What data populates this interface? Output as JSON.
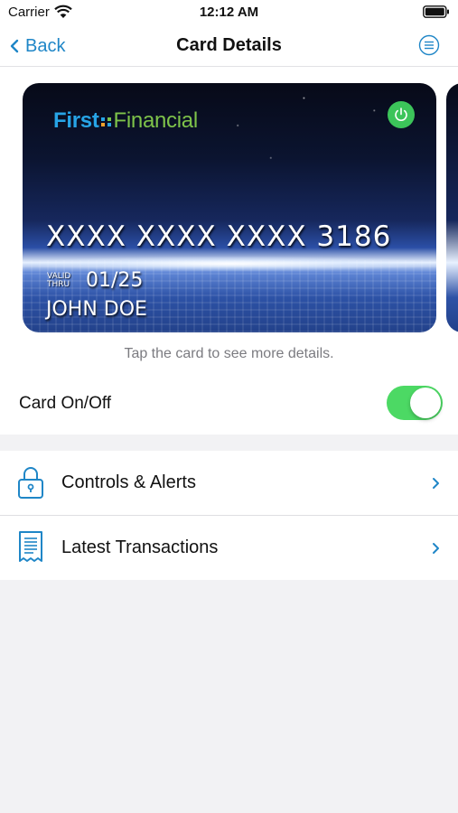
{
  "status_bar": {
    "carrier": "Carrier",
    "time": "12:12 AM"
  },
  "nav": {
    "back_label": "Back",
    "title": "Card Details"
  },
  "card": {
    "brand_first": "First",
    "brand_financial": "Financial",
    "number": "XXXX XXXX XXXX 3186",
    "valid_thru_line1": "VALID",
    "valid_thru_line2": "THRU",
    "expiry": "01/25",
    "holder": "JOHN DOE",
    "power_state": "on"
  },
  "card_hint": "Tap the card to see more details.",
  "card_toggle": {
    "label": "Card On/Off",
    "on": true
  },
  "menu": {
    "items": [
      {
        "label": "Controls & Alerts",
        "icon": "lock-icon"
      },
      {
        "label": "Latest Transactions",
        "icon": "receipt-icon"
      }
    ]
  },
  "colors": {
    "accent": "#1f86c7",
    "toggle_on": "#4cd964",
    "power_green": "#3cc45a",
    "brand_blue": "#27a4e6",
    "brand_green": "#7ec34a"
  }
}
